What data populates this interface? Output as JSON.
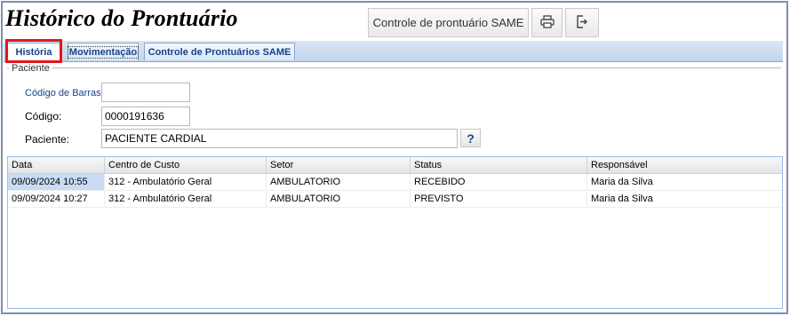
{
  "header": {
    "title": "Histórico do Prontuário",
    "same_button_label": "Controle de prontuário SAME",
    "print_icon": "printer-icon",
    "exit_icon": "exit-icon"
  },
  "tabs": [
    {
      "label": "História",
      "active": true
    },
    {
      "label": "Movimentação"
    },
    {
      "label": "Controle de Prontuários SAME"
    }
  ],
  "patient_section": {
    "legend": "Paciente",
    "barcode_label": "Código de Barras",
    "barcode_value": "",
    "code_label": "Código:",
    "code_value": "0000191636",
    "patient_label": "Paciente:",
    "patient_value": "PACIENTE CARDIAL",
    "help_label": "?"
  },
  "grid": {
    "columns": [
      "Data",
      "Centro de Custo",
      "Setor",
      "Status",
      "Responsável"
    ],
    "rows": [
      [
        "09/09/2024 10:55",
        "312 - Ambulatório Geral",
        "AMBULATORIO",
        "RECEBIDO",
        "Maria da Silva"
      ],
      [
        "09/09/2024 10:27",
        "312 - Ambulatório Geral",
        "AMBULATORIO",
        "PREVISTO",
        "Maria da Silva"
      ]
    ]
  },
  "colors": {
    "highlight": "#e8141b",
    "tab_text": "#15428b",
    "selected_cell": "#c9dcf6"
  }
}
